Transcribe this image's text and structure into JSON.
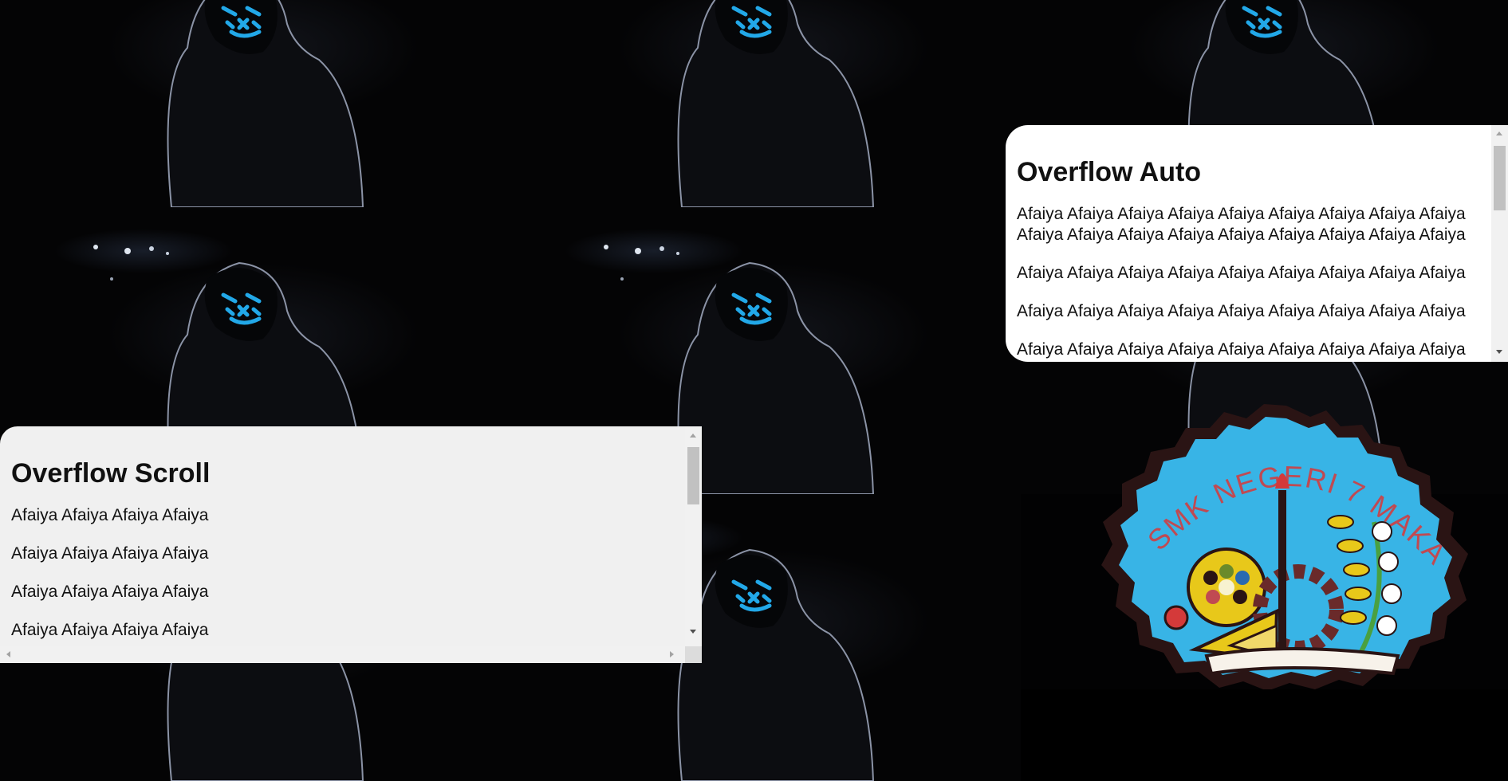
{
  "background": {
    "description_icon": "hooded-figure-neon-mask-icon",
    "mask_color": "#22a8e8"
  },
  "logo": {
    "text": "SMK NEGERI 7 MAKASSAR",
    "colors": {
      "shield": "#38b4e6",
      "outline": "#2a1414",
      "text": "#c04a52",
      "gold": "#e8c81a"
    }
  },
  "overflow_auto": {
    "title": "Overflow Auto",
    "paragraphs": [
      "Afaiya Afaiya Afaiya Afaiya Afaiya Afaiya Afaiya Afaiya Afaiya Afaiya Afaiya Afaiya Afaiya Afaiya Afaiya Afaiya Afaiya Afaiya",
      "Afaiya Afaiya Afaiya Afaiya Afaiya Afaiya Afaiya Afaiya Afaiya",
      "Afaiya Afaiya Afaiya Afaiya Afaiya Afaiya Afaiya Afaiya Afaiya",
      "Afaiya Afaiya Afaiya Afaiya Afaiya Afaiya Afaiya Afaiya Afaiya"
    ],
    "background": "#ffffff"
  },
  "overflow_scroll": {
    "title": "Overflow Scroll",
    "paragraphs": [
      "Afaiya Afaiya Afaiya Afaiya",
      "Afaiya Afaiya Afaiya Afaiya",
      "Afaiya Afaiya Afaiya Afaiya",
      "Afaiya Afaiya Afaiya Afaiya"
    ],
    "background": "#f0f0f0"
  }
}
